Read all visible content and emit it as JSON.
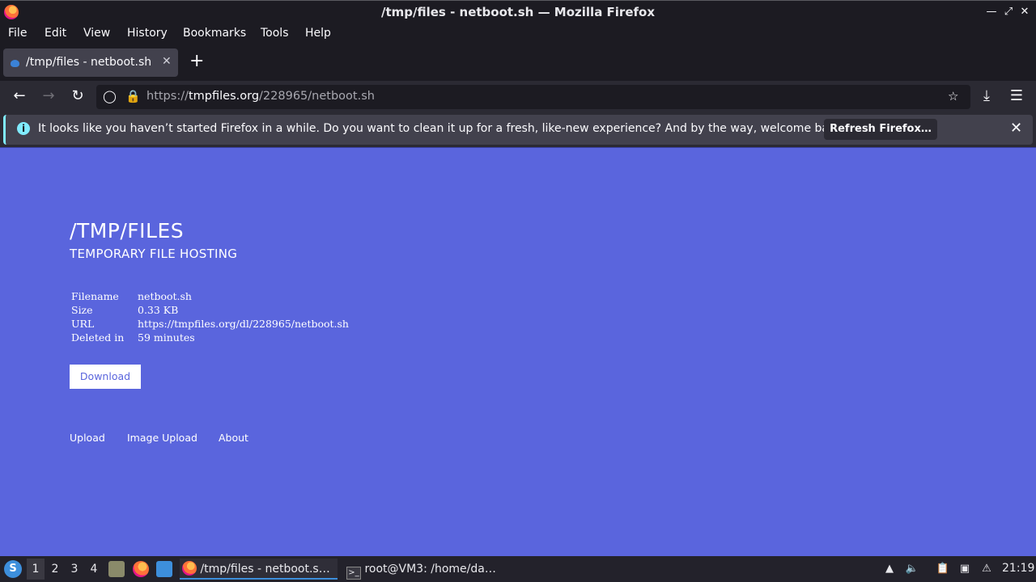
{
  "window": {
    "title": "/tmp/files - netboot.sh — Mozilla Firefox"
  },
  "menu": {
    "items": [
      "File",
      "Edit",
      "View",
      "History",
      "Bookmarks",
      "Tools",
      "Help"
    ]
  },
  "tabs": [
    {
      "label": "/tmp/files - netboot.sh"
    }
  ],
  "urlbar": {
    "prefix": "https://",
    "host": "tmpfiles.org",
    "path": "/228965/netboot.sh"
  },
  "notification": {
    "message": "It looks like you haven’t started Firefox in a while. Do you want to clean it up for a fresh, like-new experience? And by the way, welcome back!",
    "button_label": "Refresh Firefox…"
  },
  "page": {
    "title": "/TMP/FILES",
    "subtitle": "TEMPORARY FILE HOSTING",
    "file_info": [
      {
        "key": "Filename",
        "value": "netboot.sh"
      },
      {
        "key": "Size",
        "value": "0.33 KB"
      },
      {
        "key": "URL",
        "value": "https://tmpfiles.org/dl/228965/netboot.sh"
      },
      {
        "key": "Deleted in",
        "value": "59 minutes"
      }
    ],
    "download_label": "Download",
    "footer_links": [
      "Upload",
      "Image Upload",
      "About"
    ]
  },
  "taskbar": {
    "workspaces": [
      "1",
      "2",
      "3",
      "4"
    ],
    "active_workspace": "1",
    "tasks": [
      {
        "label": "/tmp/files - netboot.s…",
        "active": true
      },
      {
        "label": "root@VM3: /home/da…",
        "active": false
      }
    ],
    "clock": "21:19"
  },
  "colors": {
    "page_background": "#5a65dd",
    "browser_chrome": "#1c1b22",
    "notification_accent": "#80ebff"
  },
  "icons": [
    "firefox-icon",
    "minimize-icon",
    "restore-icon",
    "close-icon",
    "back-icon",
    "forward-icon",
    "reload-icon",
    "shield-icon",
    "lock-icon",
    "bookmark-star-icon",
    "downloads-icon",
    "hamburger-menu-icon",
    "info-icon"
  ]
}
